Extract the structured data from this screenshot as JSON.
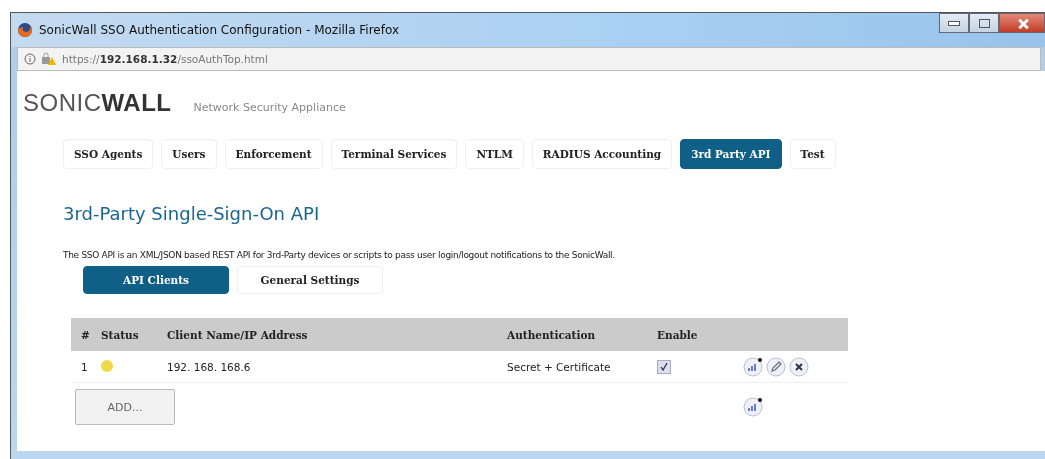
{
  "window": {
    "title": "SonicWall SSO Authentication Configuration - Mozilla Firefox"
  },
  "address_bar": {
    "host": "192.168.1.32",
    "path": "/ssoAuthTop.html",
    "scheme": "https://"
  },
  "brand": {
    "logo": "SONIC**WALL**",
    "tagline": "Network Security Appliance"
  },
  "tabs": [
    {
      "label": "SSO Agents",
      "selected": false
    },
    {
      "label": "Users",
      "selected": false
    },
    {
      "label": "Enforcement",
      "selected": false
    },
    {
      "label": "Terminal Services",
      "selected": false
    },
    {
      "label": "NTLM",
      "selected": false
    },
    {
      "label": "RADIUS Accounting",
      "selected": false
    },
    {
      "label": "3rd Party API",
      "selected": true
    },
    {
      "label": "Test",
      "selected": false
    }
  ],
  "heading": "3rd-Party Single-Sign-On API",
  "description": "The SSO API is an XML/JSON based REST API for 3rd-Party devices or scripts to pass user login/logout notifications to the SonicWall.",
  "subtabs": [
    {
      "label": "API Clients",
      "selected": true
    },
    {
      "label": "General Settings",
      "selected": false
    }
  ],
  "table": {
    "columns": [
      "#",
      "Status",
      "Client Name/IP Address",
      "Authentication",
      "Enable"
    ],
    "rows": [
      {
        "number": "1",
        "color": "#f2d94a",
        "client": "192. 168. 168.6",
        "authentication": "Secret + Certificate",
        "enabled": true
      }
    ]
  },
  "add_button": "ADD..."
}
